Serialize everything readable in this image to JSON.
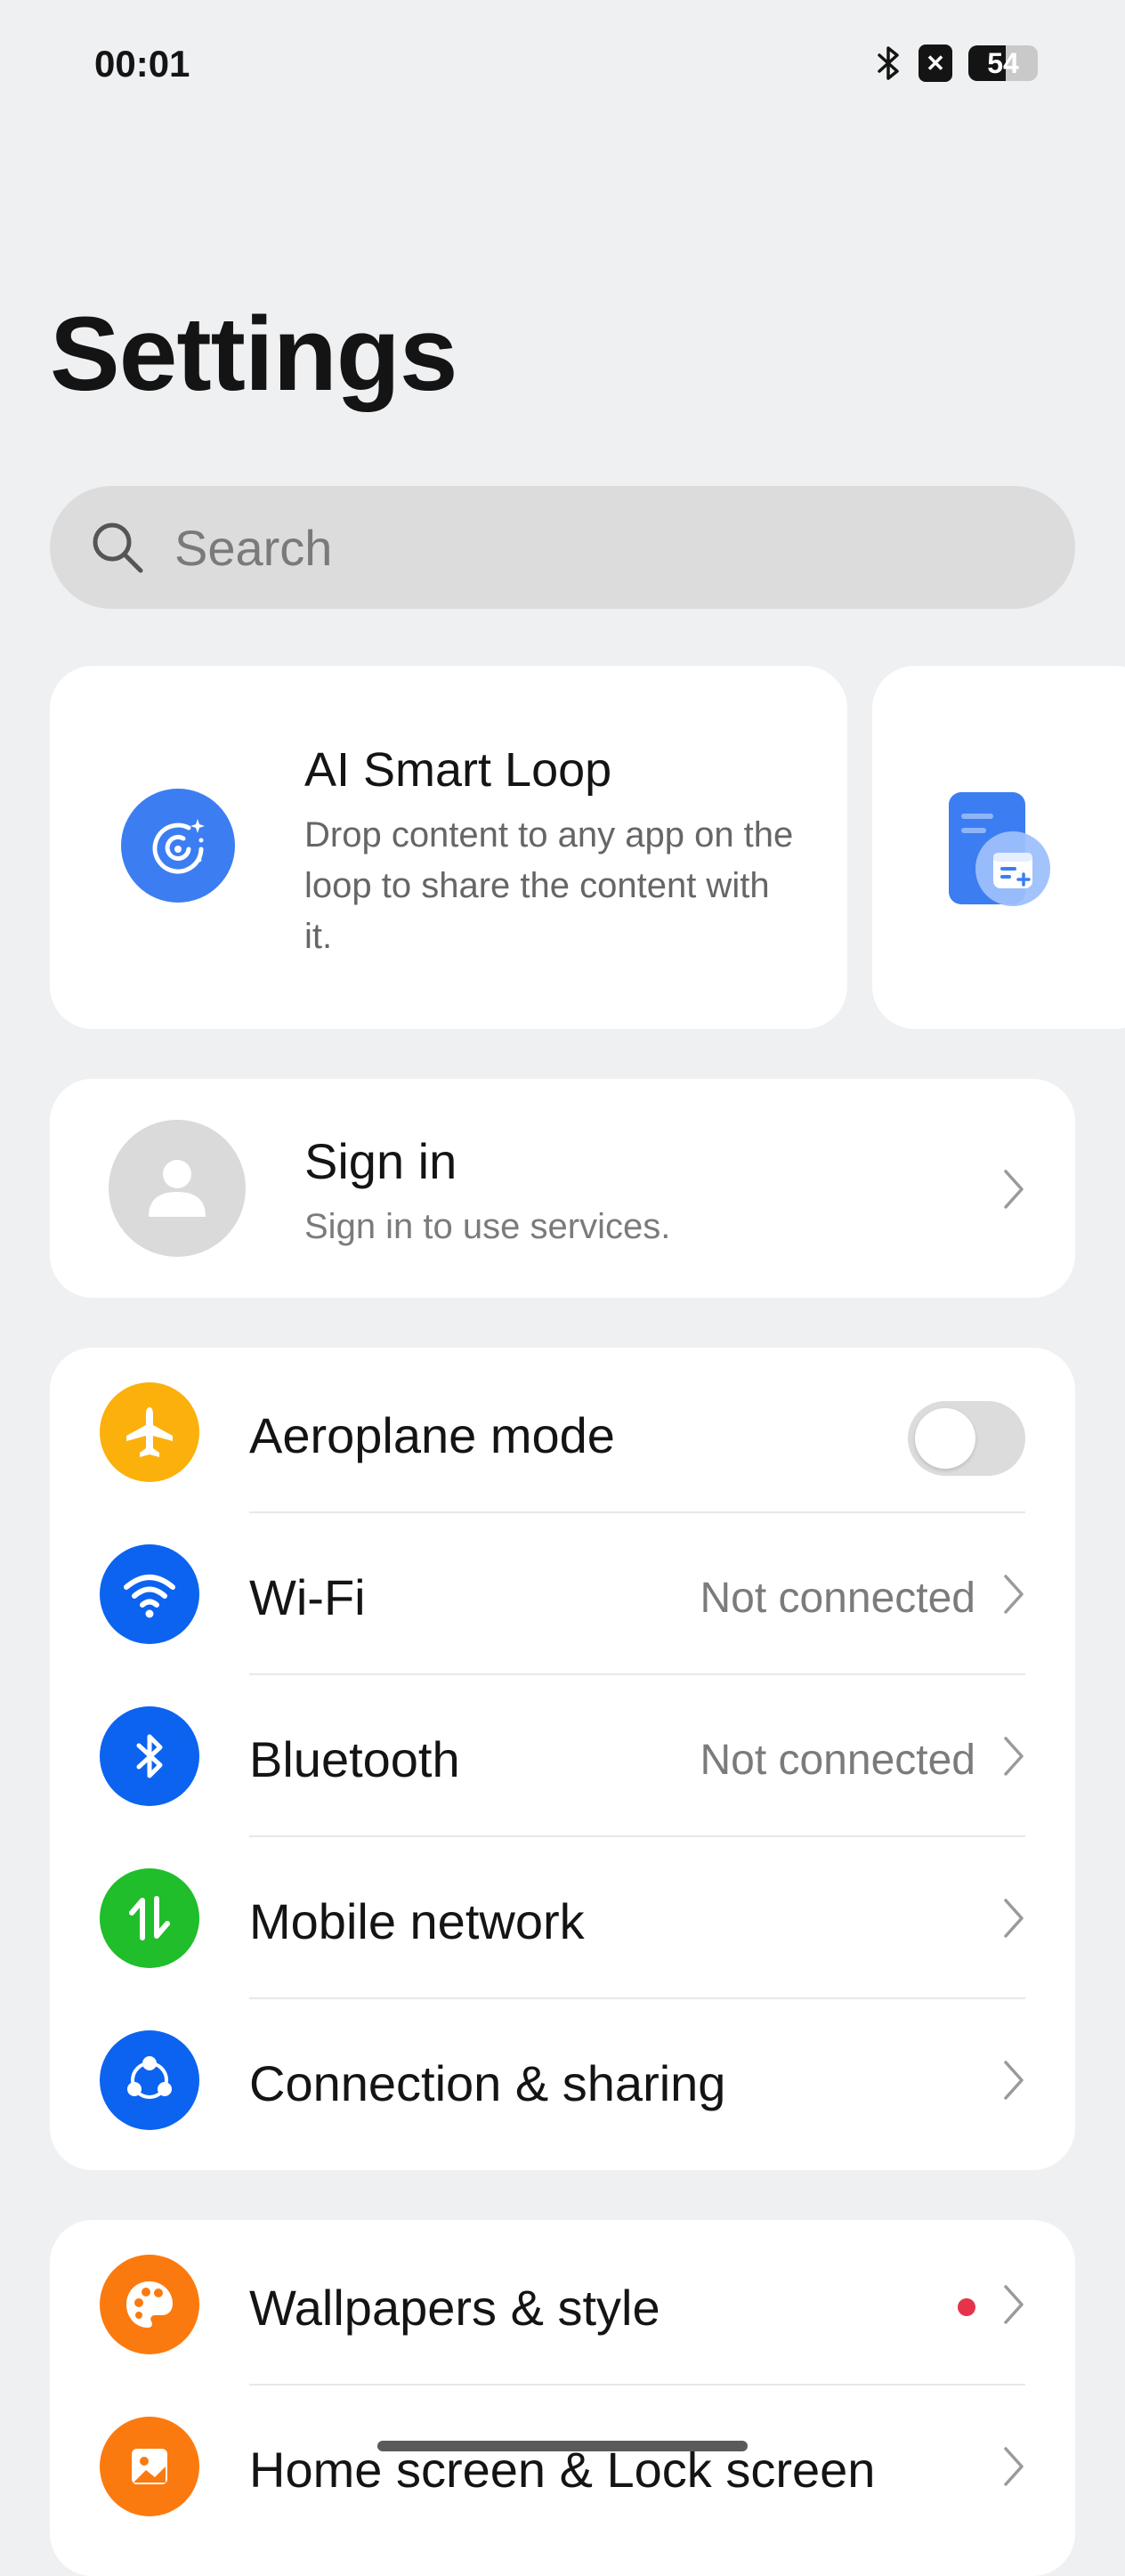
{
  "status_bar": {
    "time": "00:01",
    "battery": "54",
    "battery_level_percent": 54,
    "icons": [
      "bluetooth-icon",
      "close-box-icon",
      "battery-icon"
    ]
  },
  "page": {
    "title": "Settings"
  },
  "search": {
    "placeholder": "Search"
  },
  "feature_cards": [
    {
      "title": "AI Smart Loop",
      "description": "Drop content to any app on the loop to share the content with it.",
      "icon": "smart-loop-icon"
    },
    {
      "icon": "calendar-document-icon"
    }
  ],
  "account": {
    "title": "Sign in",
    "subtitle": "Sign in to use services."
  },
  "connectivity": [
    {
      "label": "Aeroplane mode",
      "icon": "airplane-icon",
      "color": "#fbb00c",
      "toggle": false
    },
    {
      "label": "Wi-Fi",
      "value": "Not connected",
      "icon": "wifi-icon",
      "color": "#0c63f0"
    },
    {
      "label": "Bluetooth",
      "value": "Not connected",
      "icon": "bluetooth-icon",
      "color": "#0c63f0"
    },
    {
      "label": "Mobile network",
      "icon": "mobile-network-icon",
      "color": "#1fbe2a"
    },
    {
      "label": "Connection & sharing",
      "icon": "connection-sharing-icon",
      "color": "#0c63f0"
    }
  ],
  "personalization": [
    {
      "label": "Wallpapers & style",
      "icon": "palette-icon",
      "color": "#fb7a10",
      "badge": "red-dot"
    },
    {
      "label": "Home screen & Lock screen",
      "icon": "home-screen-icon",
      "color": "#fb7a10"
    }
  ]
}
